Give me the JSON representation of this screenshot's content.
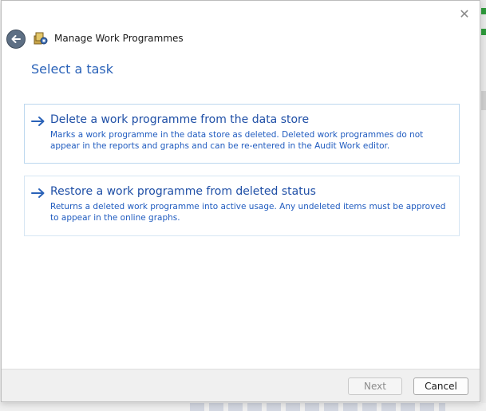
{
  "window": {
    "title": "Manage Work Programmes",
    "close_glyph": "✕"
  },
  "heading": "Select a task",
  "tasks": [
    {
      "title": "Delete a work programme from the data store",
      "description": "Marks a work programme in the data store as deleted. Deleted work programmes do not appear in the reports and graphs and can be re-entered in the Audit Work editor.",
      "icon": "arrow-right-icon"
    },
    {
      "title": "Restore a work programme from deleted status",
      "description": "Returns a deleted work programme into active usage. Any undeleted items must be approved to appear in the online graphs.",
      "icon": "arrow-right-icon"
    }
  ],
  "footer": {
    "next_label": "Next",
    "cancel_label": "Cancel"
  },
  "colors": {
    "link": "#1f4fa6",
    "heading": "#2a62b8"
  }
}
